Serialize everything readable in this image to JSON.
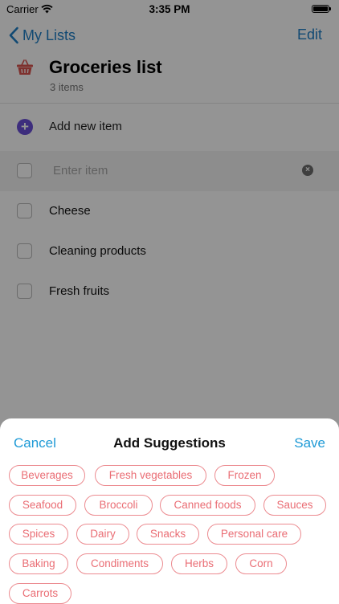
{
  "status_bar": {
    "carrier": "Carrier",
    "time": "3:35 PM"
  },
  "nav": {
    "back_label": "My Lists",
    "edit_label": "Edit"
  },
  "list": {
    "title": "Groceries list",
    "count": "3 items"
  },
  "add_item": {
    "label": "Add new item"
  },
  "new_item_input": {
    "placeholder": "Enter item",
    "value": ""
  },
  "items": [
    {
      "label": "Cheese",
      "checked": false
    },
    {
      "label": "Cleaning products",
      "checked": false
    },
    {
      "label": "Fresh fruits",
      "checked": false
    }
  ],
  "sheet": {
    "cancel_label": "Cancel",
    "title": "Add Suggestions",
    "save_label": "Save",
    "suggestions": [
      "Beverages",
      "Fresh vegetables",
      "Frozen",
      "Seafood",
      "Broccoli",
      "Canned foods",
      "Sauces",
      "Spices",
      "Dairy",
      "Snacks",
      "Personal care",
      "Baking",
      "Condiments",
      "Herbs",
      "Corn",
      "Carrots"
    ]
  },
  "colors": {
    "nav_blue": "#1e7fc6",
    "sheet_blue": "#1e9ad6",
    "add_purple": "#6a4fd8",
    "chip_text": "#ea6d74",
    "chip_border": "#ec8b90",
    "basket_red": "#d9534f"
  },
  "icons": {
    "back": "chevron-left-icon",
    "list": "basket-icon",
    "add": "plus-circle-icon",
    "clear": "clear-circle-icon",
    "wifi": "wifi-icon",
    "battery": "battery-icon"
  }
}
